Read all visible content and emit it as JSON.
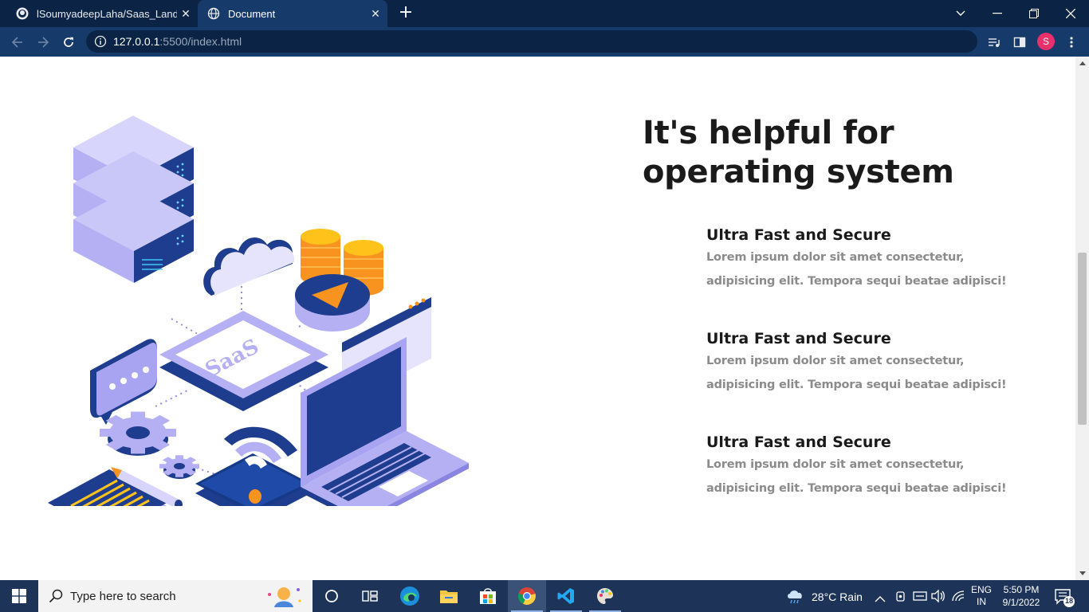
{
  "browser": {
    "tabs": [
      {
        "title": "lSoumyadeepLaha/Saas_Landing",
        "active": false,
        "favicon": "github-icon"
      },
      {
        "title": "Document",
        "active": true,
        "favicon": "globe-icon"
      }
    ],
    "url_host": "127.0.0.1",
    "url_path": ":5500/index.html",
    "profile_initial": "S"
  },
  "page": {
    "section_title": "It's helpful for operating system",
    "illustration_label": "SaaS",
    "features": [
      {
        "title": "Ultra Fast and Secure",
        "line1": "Lorem ipsum dolor sit amet consectetur,",
        "line2": "adipisicing elit. Tempora sequi beatae adipisci!"
      },
      {
        "title": "Ultra Fast and Secure",
        "line1": "Lorem ipsum dolor sit amet consectetur,",
        "line2": "adipisicing elit. Tempora sequi beatae adipisci!"
      },
      {
        "title": "Ultra Fast and Secure",
        "line1": "Lorem ipsum dolor sit amet consectetur,",
        "line2": "adipisicing elit. Tempora sequi beatae adipisci!"
      }
    ]
  },
  "taskbar": {
    "search_placeholder": "Type here to search",
    "weather": "28°C  Rain",
    "lang_line1": "ENG",
    "lang_line2": "IN",
    "time": "5:50 PM",
    "date": "9/1/2022",
    "notification_count": "18"
  },
  "colors": {
    "chrome_dark": "#0b2445",
    "chrome": "#163a69",
    "illustration_blue": "#1a3f8f",
    "illustration_lavender": "#a9a4f2",
    "illustration_orange": "#f7931e",
    "heading": "#1a1a1a",
    "body_text": "#8b8b8b"
  }
}
